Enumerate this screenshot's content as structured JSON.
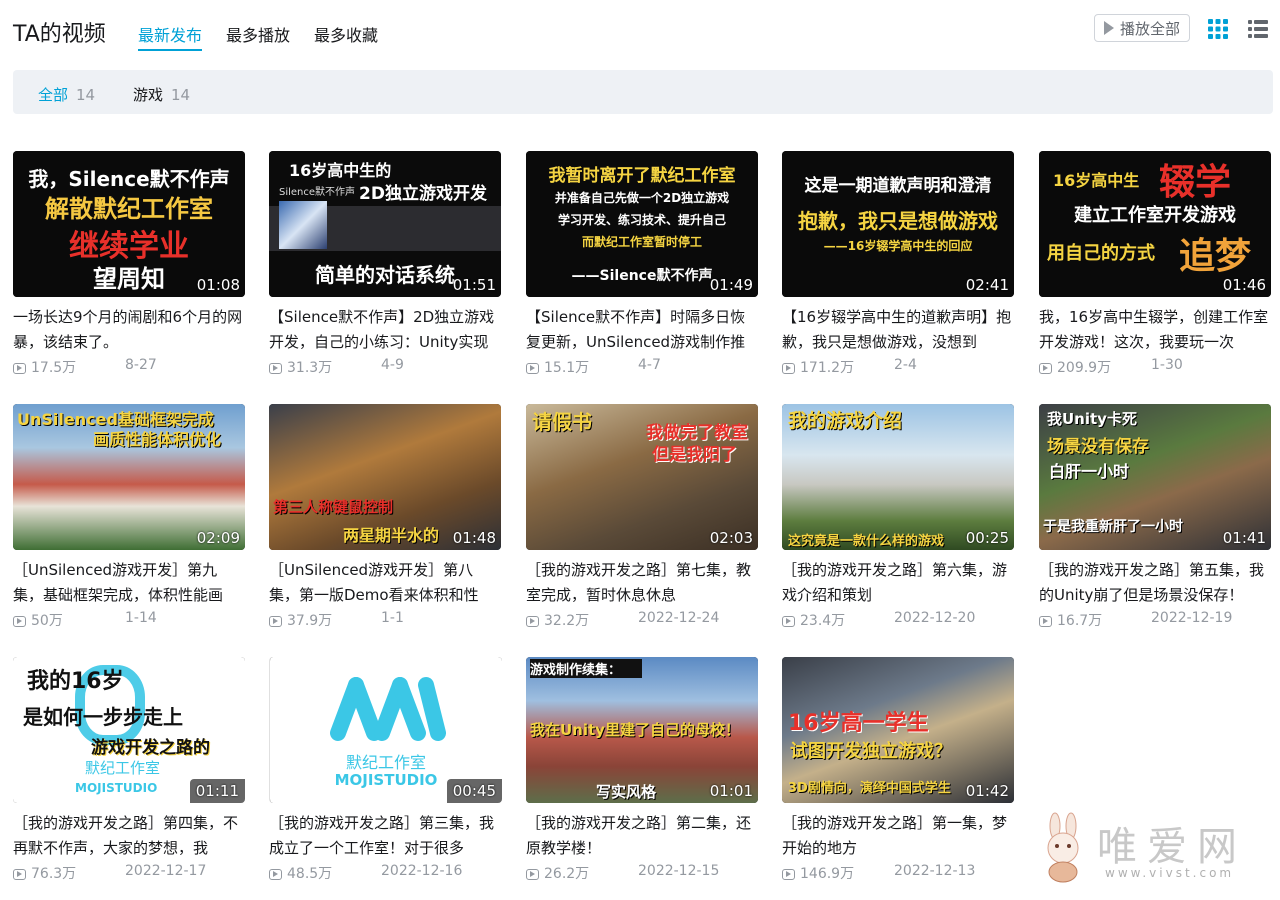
{
  "header": {
    "title": "TA的视频",
    "tabs": [
      "最新发布",
      "最多播放",
      "最多收藏"
    ],
    "play_all": "播放全部"
  },
  "filters": [
    {
      "label": "全部",
      "count": "14"
    },
    {
      "label": "游戏",
      "count": "14"
    }
  ],
  "videos": [
    {
      "title": "一场长达9个月的闹剧和6个月的网暴，该结束了。",
      "views": "17.5万",
      "date": "8-27",
      "duration": "01:08",
      "cover": [
        "我，Silence默不作声",
        "解散默纪工作室",
        "继续学业",
        "望周知"
      ]
    },
    {
      "title": "【Silence默不作声】2D独立游戏开发，自己的小练习：Unity实现",
      "views": "31.3万",
      "date": "4-9",
      "duration": "01:51",
      "cover": [
        "16岁高中生的",
        "2D独立游戏开发",
        "Silence默不作声",
        "简单的对话系统"
      ]
    },
    {
      "title": "【Silence默不作声】时隔多日恢复更新，UnSilenced游戏制作推",
      "views": "15.1万",
      "date": "4-7",
      "duration": "01:49",
      "cover": [
        "我暂时离开了默纪工作室",
        "并准备自己先做一个2D独立游戏",
        "学习开发、练习技术、提升自己",
        "而默纪工作室暂时停工",
        "——Silence默不作声"
      ]
    },
    {
      "title": "【16岁辍学高中生的道歉声明】抱歉，我只是想做游戏，没想到",
      "views": "171.2万",
      "date": "2-4",
      "duration": "02:41",
      "cover": [
        "这是一期道歉声明和澄清",
        "抱歉，我只是想做游戏",
        "——16岁辍学高中生的回应"
      ]
    },
    {
      "title": "我，16岁高中生辍学，创建工作室开发游戏！这次，我要玩一次",
      "views": "209.9万",
      "date": "1-30",
      "duration": "01:46",
      "cover": [
        "16岁高中生",
        "辍学",
        "建立工作室开发游戏",
        "用自己的方式",
        "追梦"
      ]
    },
    {
      "title": "［UnSilenced游戏开发］第九集，基础框架完成，体积性能画",
      "views": "50万",
      "date": "1-14",
      "duration": "02:09",
      "cover": [
        "UnSilenced基础框架完成",
        "画质性能体积优化"
      ]
    },
    {
      "title": "［UnSilenced游戏开发］第八集，第一版Demo看来体积和性",
      "views": "37.9万",
      "date": "1-1",
      "duration": "01:48",
      "cover": [
        "第三人称键鼠控制",
        "两星期半水的"
      ]
    },
    {
      "title": "［我的游戏开发之路］第七集，教室完成，暂时休息休息",
      "views": "32.2万",
      "date": "2022-12-24",
      "duration": "02:03",
      "cover": [
        "请假书",
        "我做完了教室",
        "但是我阳了"
      ]
    },
    {
      "title": "［我的游戏开发之路］第六集，游戏介绍和策划",
      "views": "23.4万",
      "date": "2022-12-20",
      "duration": "00:25",
      "cover": [
        "我的游戏介绍",
        "这究竟是一款什么样的游戏"
      ]
    },
    {
      "title": "［我的游戏开发之路］第五集，我的Unity崩了但是场景没保存！",
      "views": "16.7万",
      "date": "2022-12-19",
      "duration": "01:41",
      "cover": [
        "我Unity卡死",
        "场景没有保存",
        "白肝一小时",
        "于是我重新肝了一小时"
      ]
    },
    {
      "title": "［我的游戏开发之路］第四集，不再默不作声，大家的梦想，我",
      "views": "76.3万",
      "date": "2022-12-17",
      "duration": "01:11",
      "cover": [
        "我的16岁",
        "是如何一步步走上",
        "游戏开发之路的",
        "默纪工作室",
        "MOJISTUDIO"
      ]
    },
    {
      "title": "［我的游戏开发之路］第三集，我成立了一个工作室！对于很多",
      "views": "48.5万",
      "date": "2022-12-16",
      "duration": "00:45",
      "cover": [
        "默纪工作室",
        "MOJISTUDIO"
      ]
    },
    {
      "title": "［我的游戏开发之路］第二集，还原教学楼！",
      "views": "26.2万",
      "date": "2022-12-15",
      "duration": "01:01",
      "cover": [
        "游戏制作续集：",
        "我在Unity里建了自己的母校！",
        "写实风格"
      ]
    },
    {
      "title": "［我的游戏开发之路］第一集，梦开始的地方",
      "views": "146.9万",
      "date": "2022-12-13",
      "duration": "01:42",
      "cover": [
        "16岁高一学生",
        "试图开发独立游戏？",
        "3D剧情向，演绎中国式学生"
      ]
    }
  ],
  "watermark": {
    "text": "唯爱网",
    "url": "www.vivst.com"
  }
}
